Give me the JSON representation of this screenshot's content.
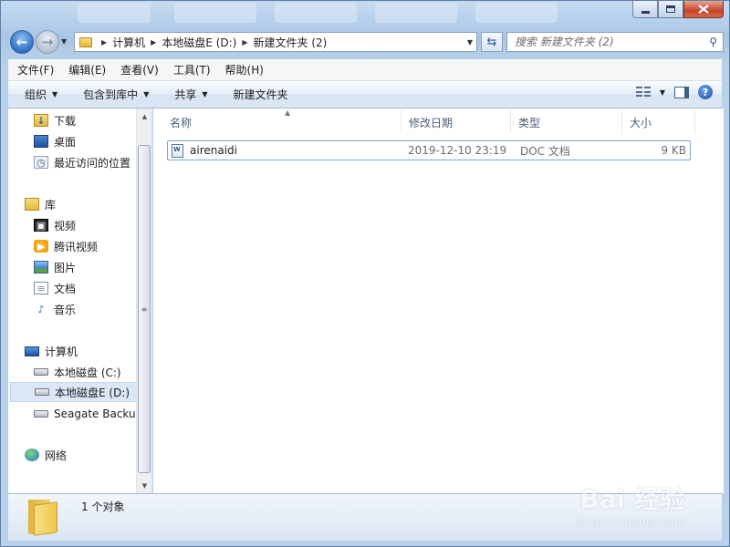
{
  "window": {
    "caption_buttons": [
      "minimize",
      "maximize",
      "close"
    ]
  },
  "nav": {
    "breadcrumbs": [
      "计算机",
      "本地磁盘E (D:)",
      "新建文件夹 (2)"
    ],
    "search_placeholder": "搜索 新建文件夹 (2)"
  },
  "menu": {
    "items": [
      "文件(F)",
      "编辑(E)",
      "查看(V)",
      "工具(T)",
      "帮助(H)"
    ]
  },
  "toolbar": {
    "organize": "组织",
    "include_library": "包含到库中",
    "share": "共享",
    "new_folder": "新建文件夹"
  },
  "sidebar": {
    "favorites": [
      {
        "label": "下载",
        "icon": "download-folder-icon"
      },
      {
        "label": "桌面",
        "icon": "desktop-icon"
      },
      {
        "label": "最近访问的位置",
        "icon": "recent-places-icon"
      }
    ],
    "libraries_label": "库",
    "libraries": [
      {
        "label": "视频",
        "icon": "video-library-icon"
      },
      {
        "label": "腾讯视频",
        "icon": "tencent-video-icon"
      },
      {
        "label": "图片",
        "icon": "pictures-library-icon"
      },
      {
        "label": "文档",
        "icon": "documents-library-icon"
      },
      {
        "label": "音乐",
        "icon": "music-library-icon"
      }
    ],
    "computer_label": "计算机",
    "drives": [
      {
        "label": "本地磁盘 (C:)",
        "icon": "system-drive-icon"
      },
      {
        "label": "本地磁盘E (D:)",
        "icon": "drive-icon",
        "selected": true
      },
      {
        "label": "Seagate Backup",
        "icon": "drive-icon"
      }
    ],
    "network_label": "网络"
  },
  "columns": {
    "name": "名称",
    "date": "修改日期",
    "type": "类型",
    "size": "大小"
  },
  "files": [
    {
      "name": "airenaidi",
      "date": "2019-12-10 23:19",
      "type": "DOC 文档",
      "size": "9 KB"
    }
  ],
  "status": {
    "count": "1 个对象"
  },
  "watermark": {
    "brand": "Bai 经验",
    "url": "jingyan.baidu.com"
  },
  "colors": {
    "frame": "#b9d1ea",
    "selection_border": "#7da2ce",
    "accent": "#1f4f9e"
  }
}
